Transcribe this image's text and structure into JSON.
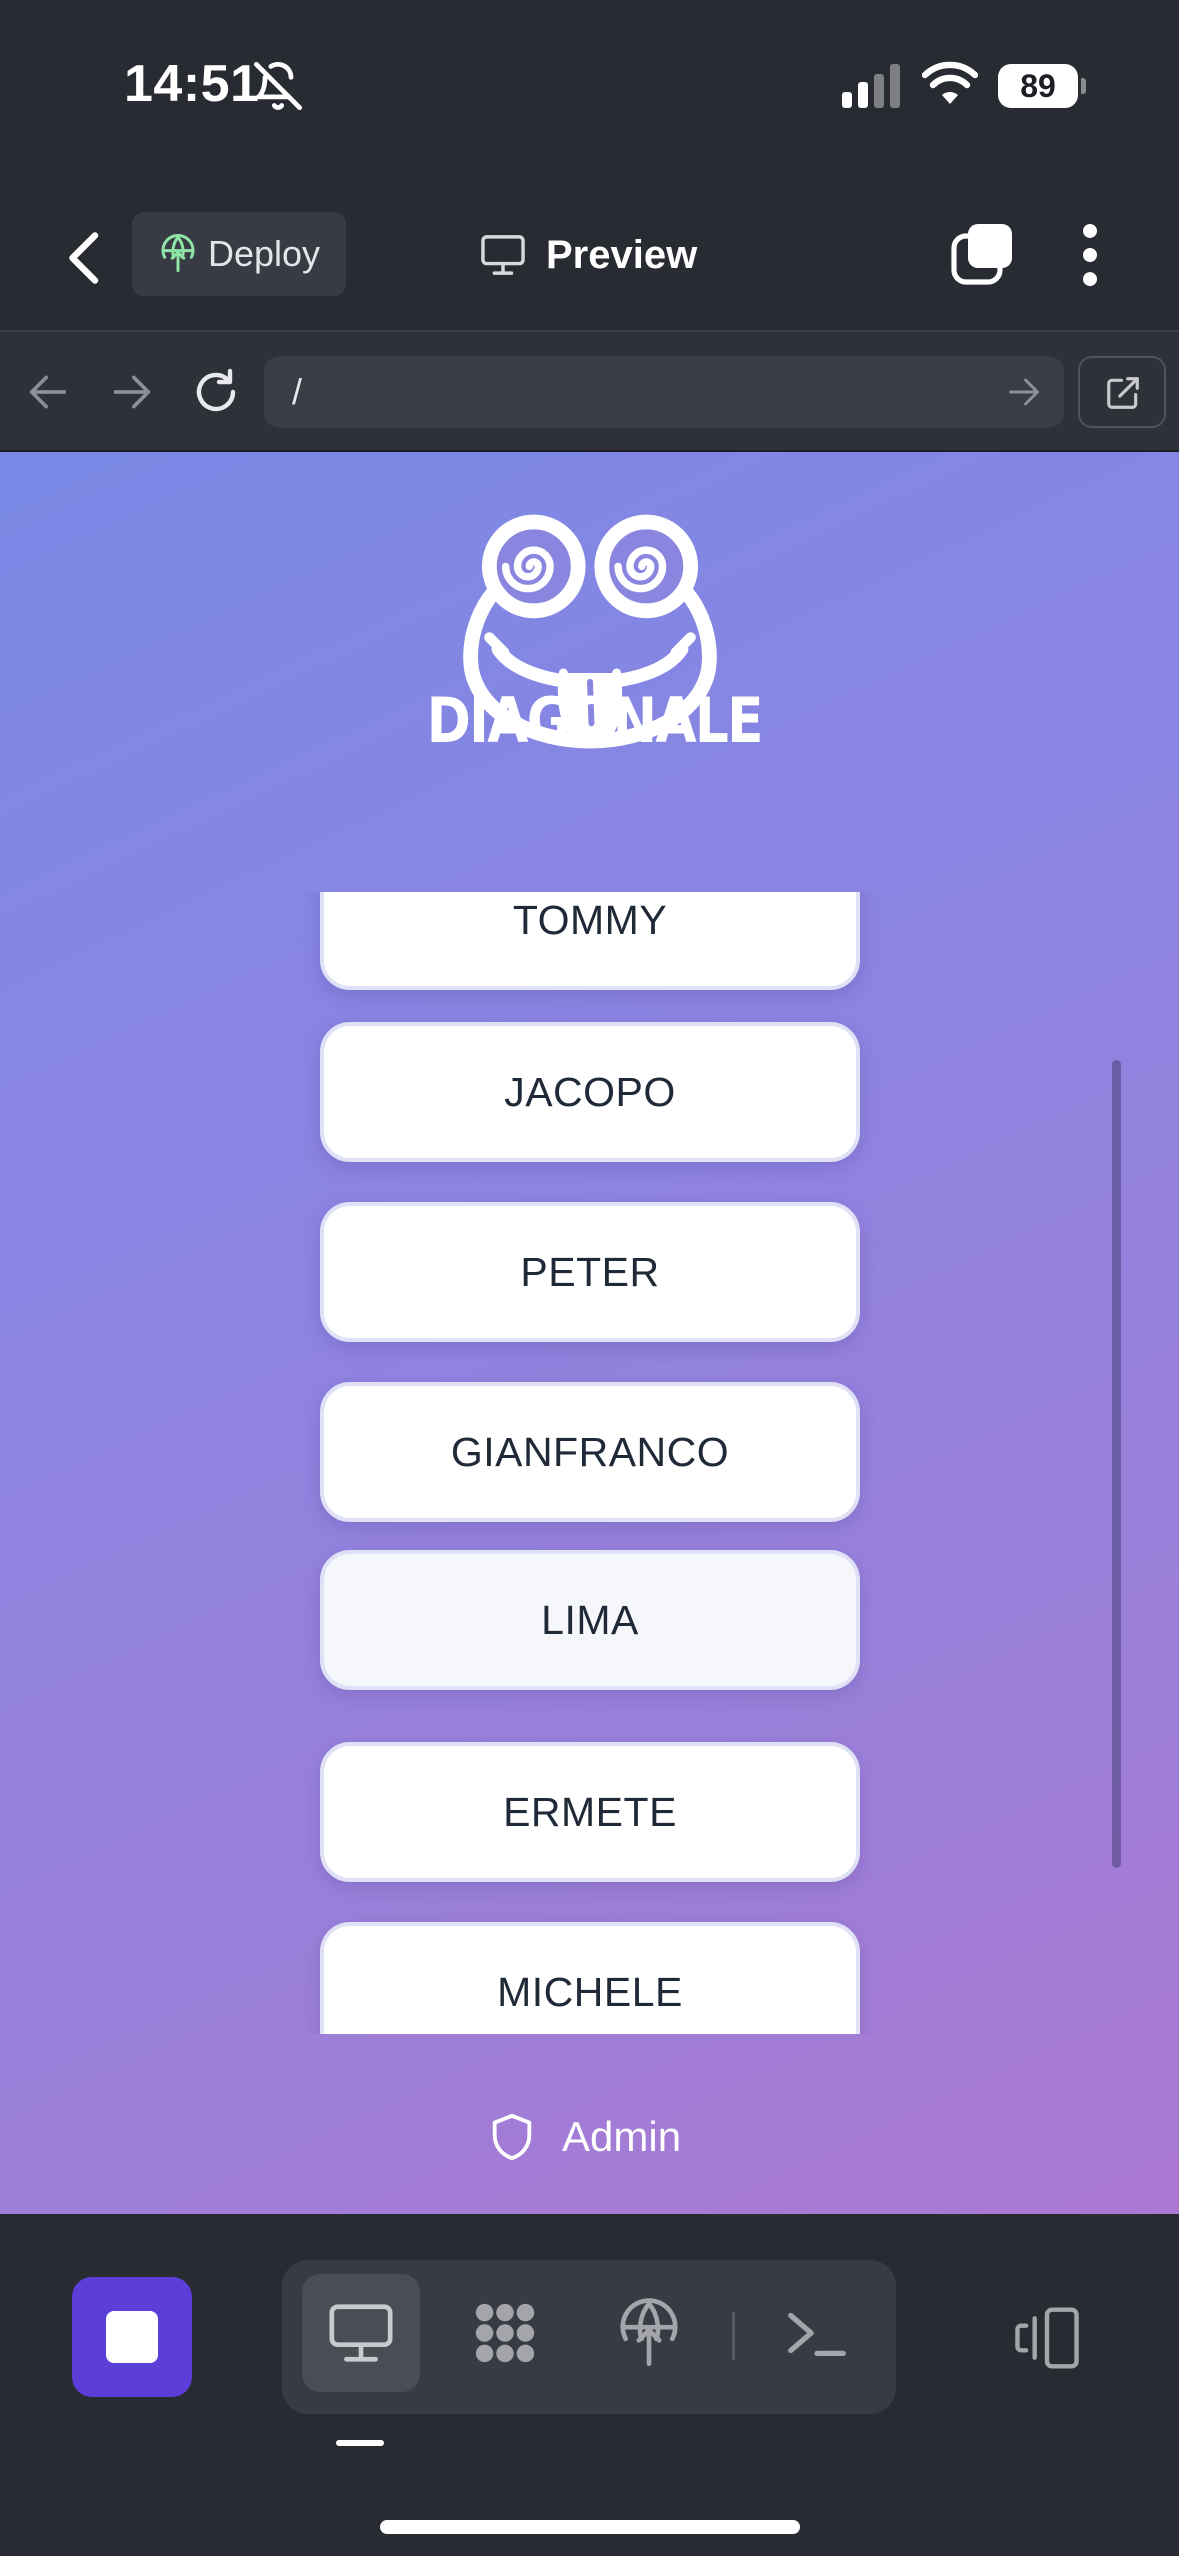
{
  "status_bar": {
    "time": "14:51",
    "battery": "89"
  },
  "header": {
    "deploy_label": "Deploy",
    "preview_label": "Preview"
  },
  "browser": {
    "url": "/"
  },
  "app": {
    "logo_text": "DIAGONALE",
    "names": [
      "TOMMY",
      "JACOPO",
      "PETER",
      "GIANFRANCO",
      "LIMA",
      "ERMETE",
      "MICHELE"
    ],
    "admin_label": "Admin"
  },
  "colors": {
    "gradient_start": "#7a8ae6",
    "gradient_end": "#ab78d2",
    "stop_button": "#5b3fd8",
    "deploy_globe": "#8fe3a6"
  },
  "icons": {
    "status": [
      "bell-slash-icon",
      "signal-icon",
      "wifi-icon"
    ],
    "header": [
      "back-icon",
      "globe-icon",
      "monitor-icon",
      "tabs-icon",
      "more-icon"
    ],
    "browser": [
      "arrow-left-icon",
      "arrow-right-icon",
      "reload-icon",
      "go-icon",
      "open-external-icon"
    ],
    "toolbar": [
      "stop-icon",
      "monitor-icon",
      "grid-icon",
      "deploy-icon",
      "terminal-icon",
      "device-toggle-icon"
    ]
  }
}
